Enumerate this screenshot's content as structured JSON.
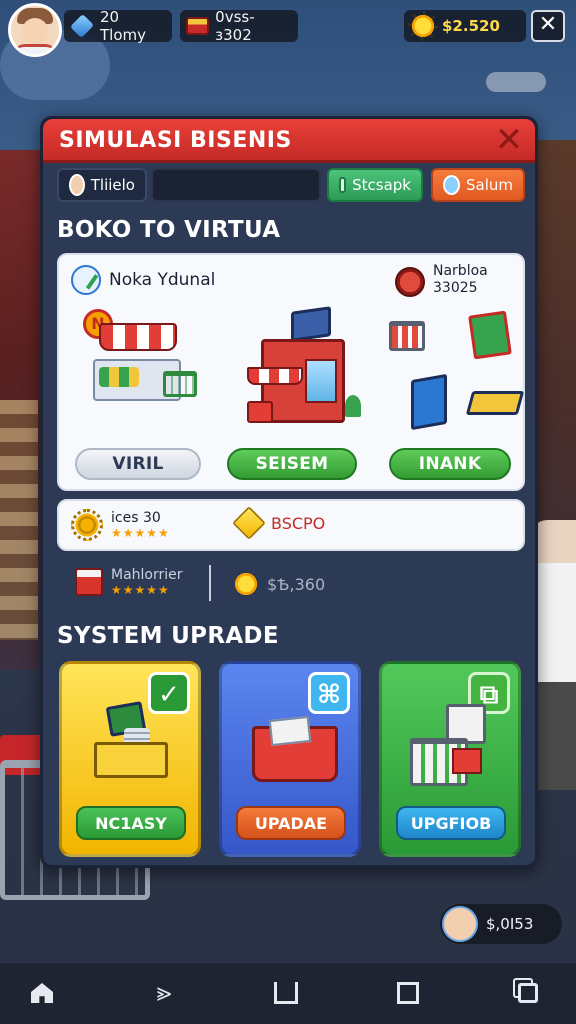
{
  "topbar": {
    "gems_text": "20 Tlomy",
    "code_text": "0vss-ɜ302",
    "money_text": "$2.520",
    "close_symbol": "✕"
  },
  "panel": {
    "title": "SIMULASI BISENIS",
    "close_symbol": "✕",
    "tabs": {
      "profile_label": "Tliielo",
      "search_value": "",
      "green_label": "Stcsapk",
      "orange_label": "Salum"
    }
  },
  "store_section": {
    "title": "BOKO TO VIRTUA",
    "store_name": "Noka Ydunal",
    "stat_line1": "Narbloa",
    "stat_line2": "33025",
    "sign_letter": "N",
    "buttons": {
      "grey": "VIRIL",
      "green1": "SEISEM",
      "green2": "INANK"
    }
  },
  "strip": {
    "item1_label": "ices 30",
    "item1_stars": "★★★★★",
    "item2_label": "BSCPO"
  },
  "stats": {
    "label": "Mahlorrier",
    "stars": "★★★★★",
    "money": "$Ѣ,360"
  },
  "upgrade_section": {
    "title": "SYSTEM UPRADE",
    "cards": [
      {
        "badge": "✓",
        "button": "NC1ASY"
      },
      {
        "badge": "⌘",
        "button": "UPADAE"
      },
      {
        "badge": "⧉",
        "button": "UPGFIOB"
      }
    ]
  },
  "balance_chip": {
    "text": "$,0I53"
  },
  "nav": {
    "fwd_symbol": "⪢"
  },
  "colors": {
    "header_red": "#e8403a",
    "panel_bg": "#2d3a55",
    "accent_gold": "#ffd94a",
    "button_green": "#339c33",
    "button_orange": "#e15a22",
    "button_blue": "#1f86c9"
  },
  "icons": {
    "gems": "blue-gem-icon",
    "code": "brick-icon",
    "money": "gold-sun-coin-icon",
    "store": "growth-arrow-icon",
    "stat": "tin-can-icon",
    "gear": "gear-icon",
    "cube": "gold-cube-icon",
    "red_box": "red-box-icon"
  }
}
